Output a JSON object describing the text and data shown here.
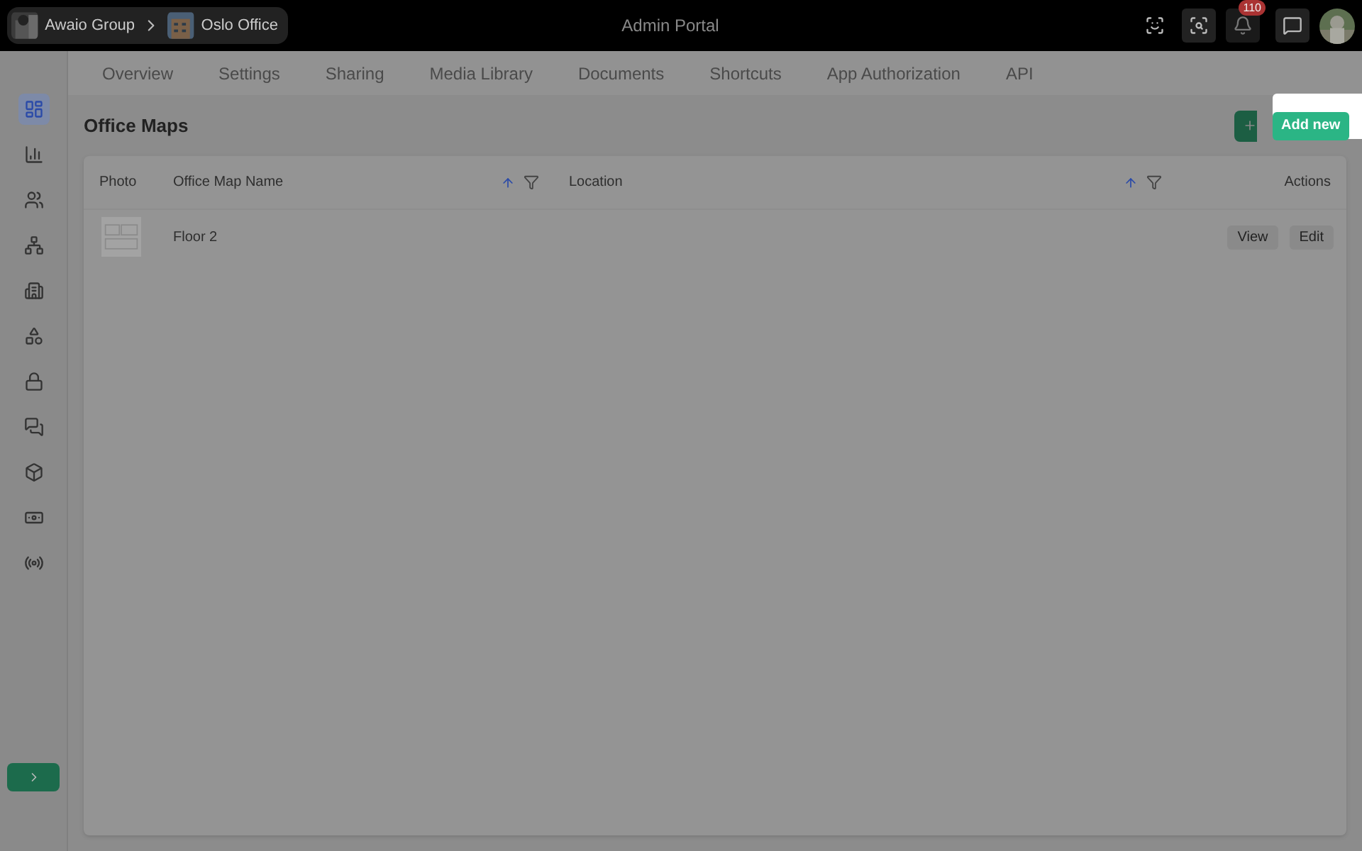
{
  "top_bar": {
    "breadcrumbs": [
      {
        "label": "Awaio Group"
      },
      {
        "label": "Oslo Office"
      }
    ],
    "title": "Admin Portal",
    "notification_count": "110"
  },
  "sidebar": {
    "items": [
      {
        "selected": true
      },
      {
        "selected": false
      },
      {
        "selected": false
      },
      {
        "selected": false
      },
      {
        "selected": false
      },
      {
        "selected": false
      },
      {
        "selected": false
      },
      {
        "selected": false
      },
      {
        "selected": false
      },
      {
        "selected": false
      },
      {
        "selected": false
      }
    ]
  },
  "tabs": [
    {
      "label": "Overview",
      "selected": false
    },
    {
      "label": "Settings",
      "selected": false
    },
    {
      "label": "Sharing",
      "selected": false
    },
    {
      "label": "Media Library",
      "selected": false
    },
    {
      "label": "Documents",
      "selected": false
    },
    {
      "label": "Shortcuts",
      "selected": false
    },
    {
      "label": "App Authorization",
      "selected": false
    },
    {
      "label": "API",
      "selected": false
    }
  ],
  "page_title": "Office Maps",
  "add_button": {
    "label": "Add new"
  },
  "table": {
    "columns": [
      {
        "label": "Photo",
        "kind": "plain"
      },
      {
        "label": "Office Map Name",
        "kind": "sortable"
      },
      {
        "label": "Location",
        "kind": "sortable"
      },
      {
        "label": "Actions",
        "kind": "plain"
      }
    ],
    "rows": [
      {
        "name": "Floor 2",
        "location_text": null,
        "actions": [
          "View",
          "Edit"
        ]
      }
    ]
  }
}
